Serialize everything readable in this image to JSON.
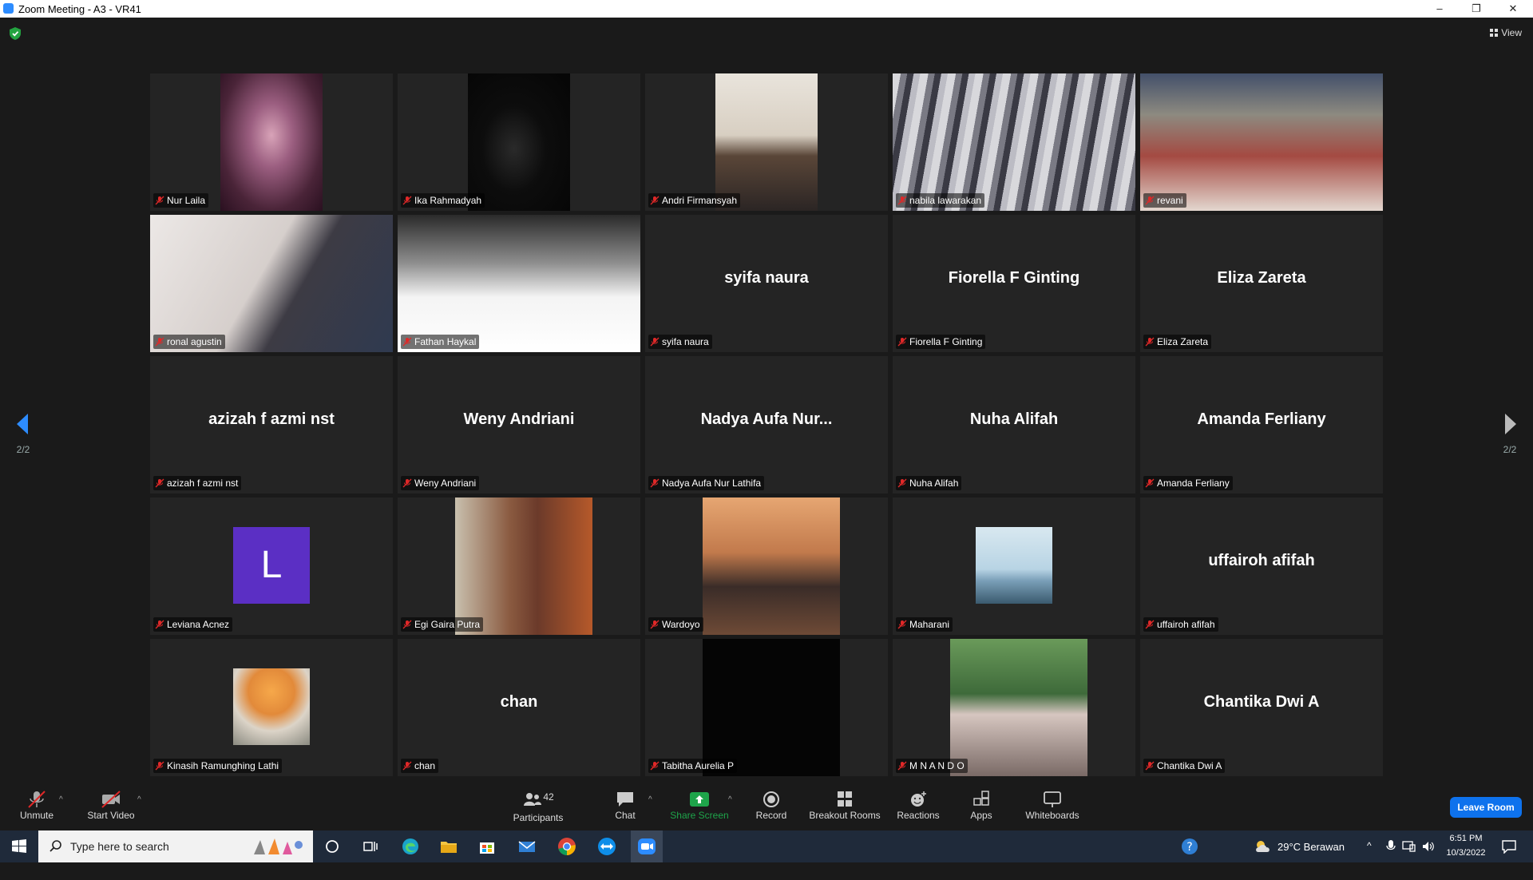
{
  "window": {
    "title": "Zoom Meeting - A3 - VR41",
    "minimize": "–",
    "maximize": "❐",
    "close": "✕"
  },
  "view_label": "View",
  "pager": {
    "left": "2/2",
    "right": "2/2"
  },
  "tiles": [
    {
      "name": "Nur Laila",
      "display": "",
      "type": "video"
    },
    {
      "name": "Ika Rahmadyah",
      "display": "",
      "type": "video"
    },
    {
      "name": "Andri Firmansyah",
      "display": "",
      "type": "video"
    },
    {
      "name": "nabila lawarakan",
      "display": "",
      "type": "video"
    },
    {
      "name": "revani",
      "display": "",
      "type": "video"
    },
    {
      "name": "ronal agustin",
      "display": "",
      "type": "video"
    },
    {
      "name": "Fathan Haykal",
      "display": "",
      "type": "video"
    },
    {
      "name": "syifa naura",
      "display": "syifa naura",
      "type": "name"
    },
    {
      "name": "Fiorella F Ginting",
      "display": "Fiorella F Ginting",
      "type": "name"
    },
    {
      "name": "Eliza Zareta",
      "display": "Eliza Zareta",
      "type": "name"
    },
    {
      "name": "azizah f azmi nst",
      "display": "azizah f azmi nst",
      "type": "name"
    },
    {
      "name": "Weny Andriani",
      "display": "Weny Andriani",
      "type": "name"
    },
    {
      "name": "Nadya Aufa Nur Lathifa",
      "display": "Nadya  Aufa  Nur...",
      "type": "name"
    },
    {
      "name": "Nuha Alifah",
      "display": "Nuha Alifah",
      "type": "name"
    },
    {
      "name": "Amanda Ferliany",
      "display": "Amanda Ferliany",
      "type": "name"
    },
    {
      "name": "Leviana Acnez",
      "display": "L",
      "type": "avatar"
    },
    {
      "name": "Egi Gaira Putra",
      "display": "",
      "type": "photo"
    },
    {
      "name": "Wardoyo",
      "display": "",
      "type": "photo"
    },
    {
      "name": "Maharani",
      "display": "",
      "type": "photo"
    },
    {
      "name": "uffairoh afifah",
      "display": "uffairoh afifah",
      "type": "name"
    },
    {
      "name": "Kinasih Ramunghing Lathi",
      "display": "",
      "type": "photo"
    },
    {
      "name": "chan",
      "display": "chan",
      "type": "name"
    },
    {
      "name": "Tabitha Aurelia P",
      "display": "",
      "type": "black"
    },
    {
      "name": "M N A N D O",
      "display": "",
      "type": "photo"
    },
    {
      "name": "Chantika Dwi A",
      "display": "Chantika Dwi A",
      "type": "name"
    }
  ],
  "toolbar": {
    "unmute": "Unmute",
    "start_video": "Start Video",
    "participants": "Participants",
    "participants_count": "42",
    "chat": "Chat",
    "share_screen": "Share Screen",
    "record": "Record",
    "breakout_rooms": "Breakout Rooms",
    "reactions": "Reactions",
    "apps": "Apps",
    "whiteboards": "Whiteboards",
    "leave": "Leave Room"
  },
  "taskbar": {
    "search_placeholder": "Type here to search",
    "weather": "29°C  Berawan",
    "time": "6:51 PM",
    "date": "10/3/2022"
  },
  "colors": {
    "accent": "#0e72ed",
    "share_green": "#1ea44a",
    "avatar_purple": "#5b2fc4"
  }
}
